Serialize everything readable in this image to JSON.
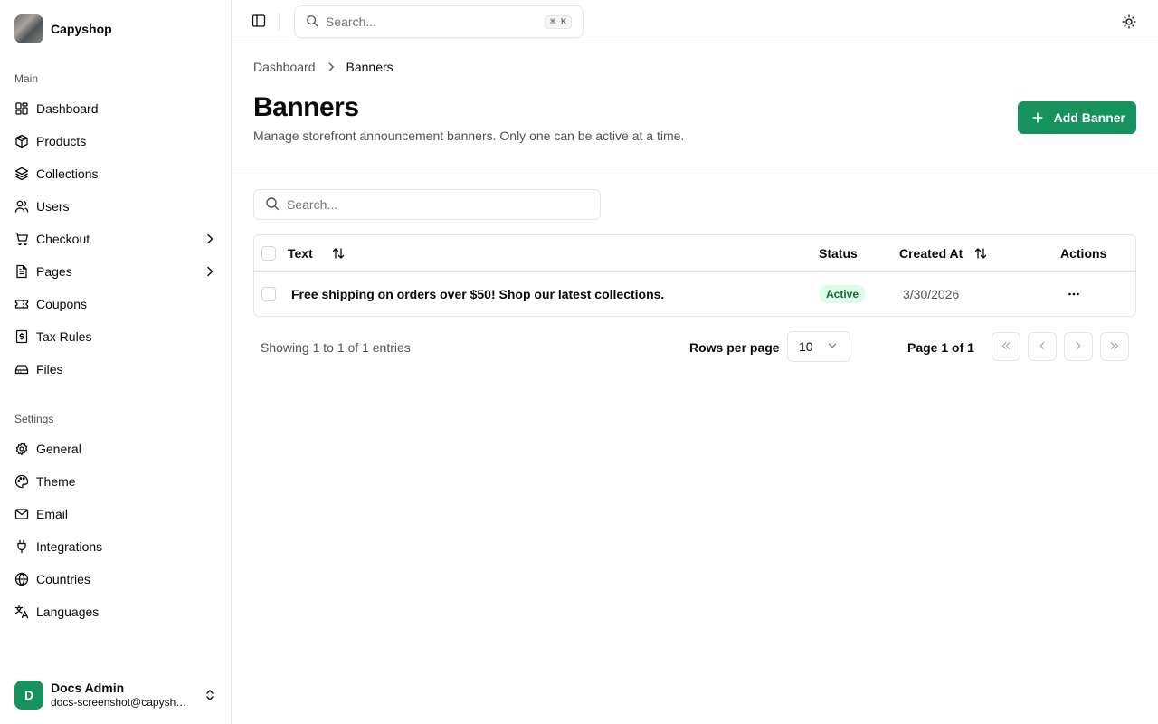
{
  "brand": {
    "name": "Capyshop"
  },
  "sidebar": {
    "main_label": "Main",
    "main_items": [
      {
        "label": "Dashboard",
        "icon": "dashboard-icon"
      },
      {
        "label": "Products",
        "icon": "package-icon"
      },
      {
        "label": "Collections",
        "icon": "layers-icon"
      },
      {
        "label": "Users",
        "icon": "users-icon"
      },
      {
        "label": "Checkout",
        "icon": "cart-icon",
        "expandable": true
      },
      {
        "label": "Pages",
        "icon": "file-icon",
        "expandable": true
      },
      {
        "label": "Coupons",
        "icon": "ticket-icon"
      },
      {
        "label": "Tax Rules",
        "icon": "receipt-icon"
      },
      {
        "label": "Files",
        "icon": "drive-icon"
      }
    ],
    "settings_label": "Settings",
    "settings_items": [
      {
        "label": "General",
        "icon": "gear-icon"
      },
      {
        "label": "Theme",
        "icon": "palette-icon"
      },
      {
        "label": "Email",
        "icon": "mail-icon"
      },
      {
        "label": "Integrations",
        "icon": "plug-icon"
      },
      {
        "label": "Countries",
        "icon": "globe-icon"
      },
      {
        "label": "Languages",
        "icon": "languages-icon"
      }
    ]
  },
  "user": {
    "initial": "D",
    "name": "Docs Admin",
    "email": "docs-screenshot@capyshop.com"
  },
  "topbar": {
    "search_placeholder": "Search...",
    "shortcut": "⌘ K"
  },
  "breadcrumb": {
    "parent": "Dashboard",
    "current": "Banners"
  },
  "page": {
    "title": "Banners",
    "description": "Manage storefront announcement banners. Only one can be active at a time.",
    "add_button": "Add Banner"
  },
  "table": {
    "search_placeholder": "Search...",
    "columns": {
      "text": "Text",
      "status": "Status",
      "created": "Created At",
      "actions": "Actions"
    },
    "rows": [
      {
        "text": "Free shipping on orders over $50! Shop our latest collections.",
        "status": "Active",
        "created": "3/30/2026"
      }
    ]
  },
  "pagination": {
    "showing": "Showing 1 to 1 of 1 entries",
    "rows_per_page_label": "Rows per page",
    "rows_per_page": "10",
    "page_info": "Page 1 of 1"
  },
  "colors": {
    "accent": "#15925e",
    "badge_bg": "#dcfce7",
    "badge_text": "#166534",
    "border": "#e5e5e5"
  }
}
